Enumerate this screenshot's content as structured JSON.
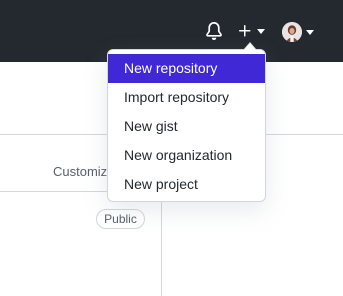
{
  "header": {
    "icons": {
      "notifications": "bell-icon",
      "create": "plus-icon",
      "avatar": "user-avatar"
    }
  },
  "dropdown": {
    "items": [
      {
        "label": "New repository",
        "active": true
      },
      {
        "label": "Import repository"
      },
      {
        "label": "New gist"
      },
      {
        "label": "New organization"
      },
      {
        "label": "New project"
      }
    ]
  },
  "main": {
    "customize_label": "Customize",
    "visibility_badge": "Public"
  },
  "colors": {
    "header_bg": "#24292f",
    "menu_active_bg": "#4028d6",
    "border": "#d0d7de"
  }
}
